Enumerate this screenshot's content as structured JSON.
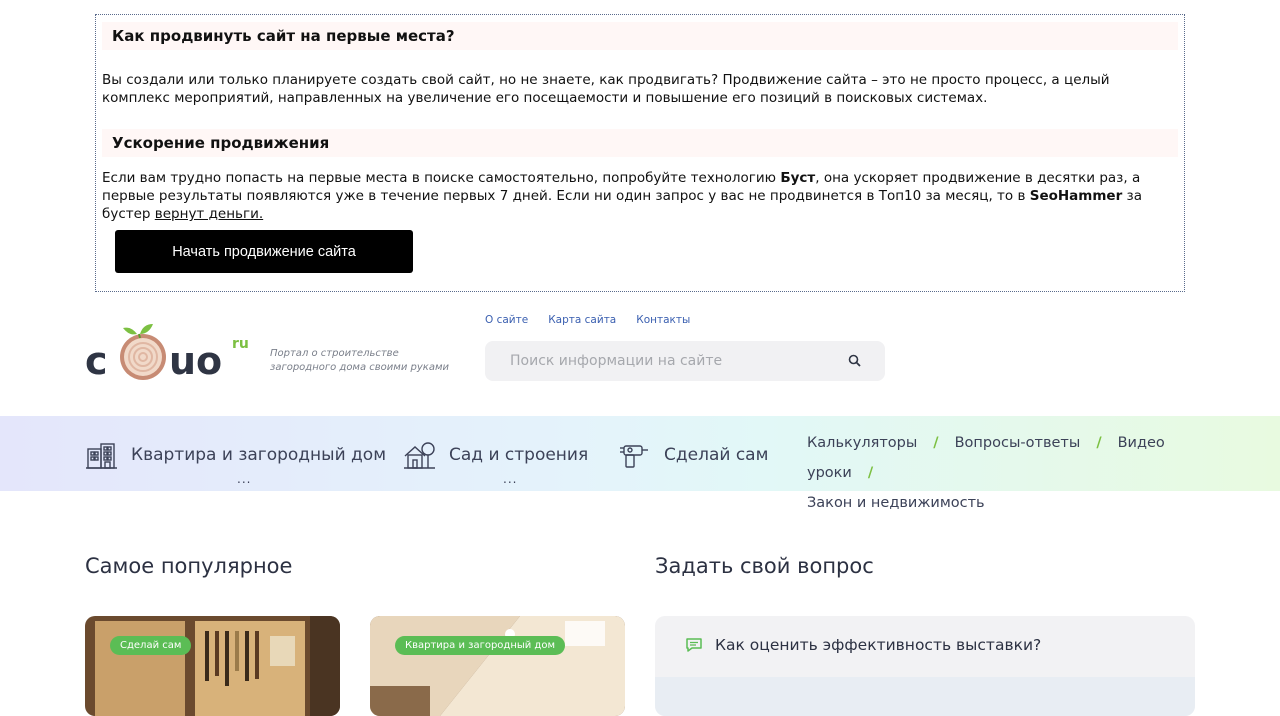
{
  "promo": {
    "heading1": "Как продвинуть сайт на первые места?",
    "text1": "Вы создали или только планируете создать свой сайт, но не знаете, как продвигать? Продвижение сайта – это не просто процесс, а целый комплекс мероприятий, направленных на увеличение его посещаемости и повышение его позиций в поисковых системах.",
    "heading2": "Ускорение продвижения",
    "text2_a": "Если вам трудно попасть на первые места в поиске самостоятельно, попробуйте технологию ",
    "text2_bold1": "Буст",
    "text2_b": ", она ускоряет продвижение в десятки раз, а первые результаты появляются уже в течение первых 7 дней. Если ни один запрос у вас не продвинется в Топ10 за месяц, то в ",
    "text2_bold2": "SeoHammer",
    "text2_c": " за бустер ",
    "text2_link": "вернут деньги.",
    "cta_label": "Начать продвижение сайта"
  },
  "header": {
    "logo_text": "uo",
    "logo_suffix": "ru",
    "tagline": "Портал о строительстве загородного дома своими руками",
    "toplinks": [
      "О сайте",
      "Карта сайта",
      "Контакты"
    ],
    "search_placeholder": "Поиск информации на сайте"
  },
  "nav": {
    "items": [
      {
        "label": "Квартира и загородный дом",
        "icon": "apartment-building-icon",
        "dots": "..."
      },
      {
        "label": "Сад и строения",
        "icon": "garden-house-icon",
        "dots": "..."
      },
      {
        "label": "Сделай сам",
        "icon": "drill-tool-icon"
      }
    ],
    "links": [
      "Калькуляторы",
      "Вопросы-ответы",
      "Видео уроки",
      "Закон и недвижимость"
    ],
    "separator": "/"
  },
  "popular": {
    "title": "Самое популярное",
    "cards": [
      {
        "tag": "Сделай сам"
      },
      {
        "tag": "Квартира и загородный дом"
      }
    ]
  },
  "ask": {
    "title": "Задать свой вопрос",
    "questions": [
      "Как оценить эффективность выставки?"
    ]
  },
  "colors": {
    "accent_green": "#5bbd55",
    "link_blue": "#3a5fb0",
    "cta_bg": "#000000"
  }
}
